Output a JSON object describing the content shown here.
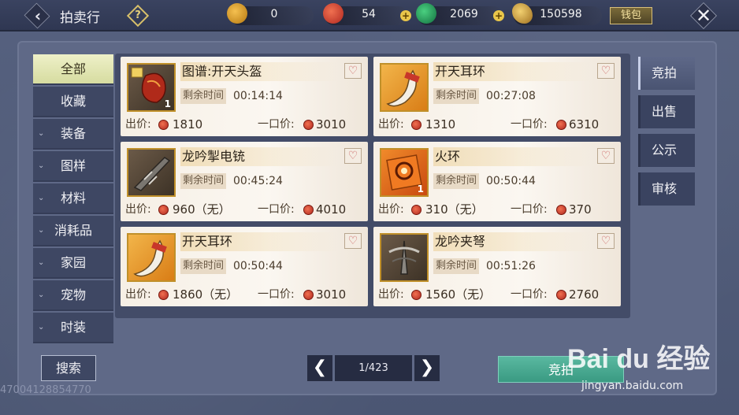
{
  "header": {
    "title": "拍卖行",
    "help_glyph": "?",
    "wallet_label": "钱包",
    "currencies": [
      {
        "name": "bound-coin",
        "value": "0",
        "color": "#e0a030"
      },
      {
        "name": "red-jade",
        "value": "54",
        "color": "#d24a30"
      },
      {
        "name": "green-jade",
        "value": "2069",
        "color": "#28a060"
      },
      {
        "name": "gold-leaf",
        "value": "150598",
        "color": "#d9a540"
      }
    ]
  },
  "categories": [
    {
      "label": "全部",
      "active": true,
      "expandable": false
    },
    {
      "label": "收藏",
      "active": false,
      "expandable": false
    },
    {
      "label": "装备",
      "active": false,
      "expandable": true
    },
    {
      "label": "图样",
      "active": false,
      "expandable": true
    },
    {
      "label": "材料",
      "active": false,
      "expandable": true
    },
    {
      "label": "消耗品",
      "active": false,
      "expandable": true
    },
    {
      "label": "家园",
      "active": false,
      "expandable": true
    },
    {
      "label": "宠物",
      "active": false,
      "expandable": true
    },
    {
      "label": "时装",
      "active": false,
      "expandable": true
    }
  ],
  "listing": {
    "time_label": "剩余时间",
    "bid_label": "出价:",
    "buy_label": "一口价:",
    "items": [
      {
        "name": "图谱:开天头盔",
        "time": "00:14:14",
        "bid": "1810",
        "buy": "3010",
        "qty": "1",
        "frame": "dark",
        "icon": "helmet-icon"
      },
      {
        "name": "开天耳环",
        "time": "00:27:08",
        "bid": "1310",
        "buy": "6310",
        "qty": "",
        "frame": "orange",
        "icon": "earring-icon"
      },
      {
        "name": "龙吟掣电铳",
        "time": "00:45:24",
        "bid": "960（无）",
        "buy": "4010",
        "qty": "",
        "frame": "dark",
        "icon": "gun-icon"
      },
      {
        "name": "火环",
        "time": "00:50:44",
        "bid": "310（无）",
        "buy": "370",
        "qty": "1",
        "frame": "red",
        "icon": "fire-ring-icon"
      },
      {
        "name": "开天耳环",
        "time": "00:50:44",
        "bid": "1860（无）",
        "buy": "3010",
        "qty": "",
        "frame": "orange",
        "icon": "earring-icon"
      },
      {
        "name": "龙吟夹弩",
        "time": "00:51:26",
        "bid": "1560（无）",
        "buy": "2760",
        "qty": "",
        "frame": "dark",
        "icon": "crossbow-icon"
      }
    ]
  },
  "right_tabs": [
    {
      "label": "竞拍",
      "active": true
    },
    {
      "label": "出售",
      "active": false
    },
    {
      "label": "公示",
      "active": false
    },
    {
      "label": "审核",
      "active": false
    }
  ],
  "footer": {
    "search_label": "搜索",
    "prev_glyph": "❮",
    "next_glyph": "❯",
    "page_indicator": "1/423",
    "bid_button_label": "竞拍",
    "player_id": "47004128854770"
  },
  "watermark": {
    "logo": "Bai du 经验",
    "sub": "jingyan.baidu.com"
  }
}
